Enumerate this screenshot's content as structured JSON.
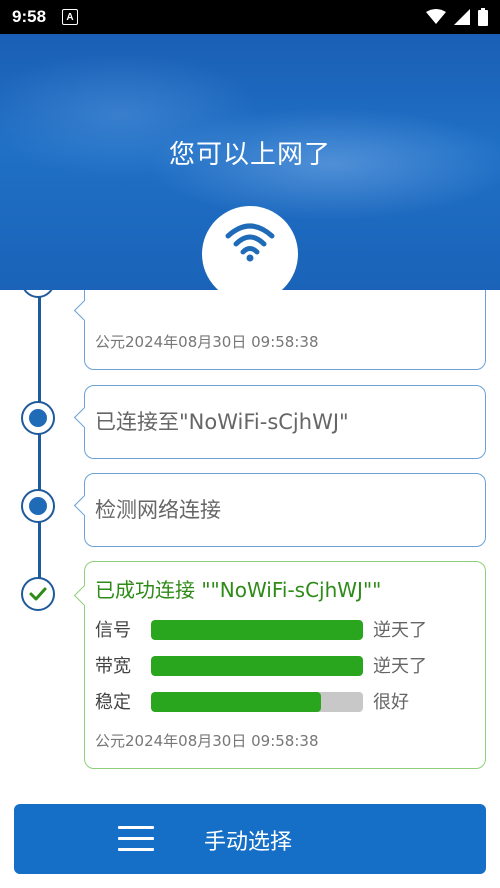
{
  "status_bar": {
    "time": "9:58",
    "notification_icon": "A",
    "icons": [
      "wifi-icon",
      "cellular-icon",
      "battery-icon"
    ]
  },
  "hero": {
    "title": "您可以上网了",
    "icon": "wifi-icon"
  },
  "timeline": {
    "items": [
      {
        "text": "",
        "timestamp": "公元2024年08月30日 09:58:38"
      },
      {
        "text": "已连接至\"NoWiFi-sCjhWJ\""
      },
      {
        "text": "检测网络连接"
      },
      {
        "title": "已成功连接 \"\"NoWiFi-sCjhWJ\"\"",
        "metrics": [
          {
            "label": "信号",
            "level": 1.0,
            "status": "逆天了"
          },
          {
            "label": "带宽",
            "level": 1.0,
            "status": "逆天了"
          },
          {
            "label": "稳定",
            "level": 0.8,
            "status": "很好"
          }
        ],
        "timestamp": "公元2024年08月30日 09:58:38"
      }
    ]
  },
  "colors": {
    "primary": "#156fc6",
    "success": "#2aa61e",
    "success_text": "#2e8b17"
  },
  "bottom_button": {
    "label": "手动选择",
    "icon": "menu-icon"
  }
}
